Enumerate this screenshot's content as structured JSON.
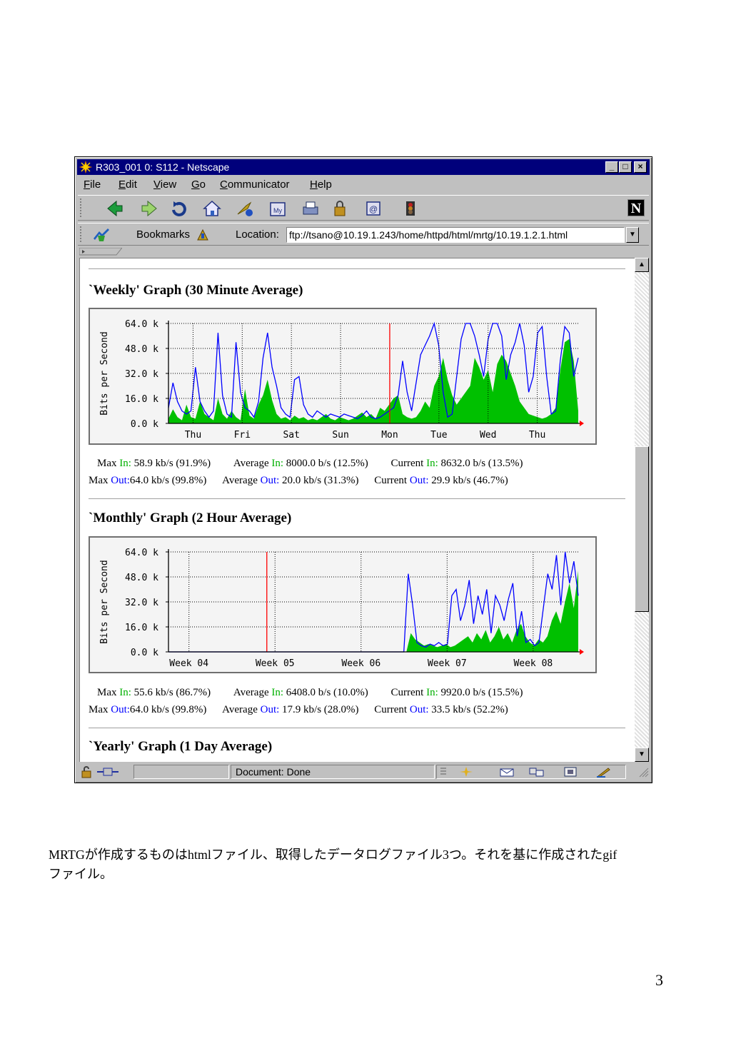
{
  "window": {
    "title": "R303_001 0: S112 - Netscape",
    "buttons": [
      "_",
      "□",
      "×"
    ]
  },
  "menu": [
    {
      "key": "F",
      "rest": "ile"
    },
    {
      "key": "E",
      "rest": "dit"
    },
    {
      "key": "V",
      "rest": "iew"
    },
    {
      "key": "G",
      "rest": "o"
    },
    {
      "key": "C",
      "rest": "ommunicator"
    },
    {
      "key": "H",
      "rest": "elp"
    }
  ],
  "toolbar": {
    "icons": [
      "back-icon",
      "forward-icon",
      "reload-icon",
      "home-icon",
      "search-icon",
      "my-netscape-icon",
      "print-icon",
      "security-icon",
      "stop-at-icon",
      "stop-icon"
    ],
    "brand": "N"
  },
  "location": {
    "bookmarks_label": "Bookmarks",
    "location_label": "Location:",
    "url": "ftp://tsano@10.19.1.243/home/httpd/html/mrtg/10.19.1.2.1.html"
  },
  "content": {
    "weekly": {
      "heading": "`Weekly' Graph (30 Minute Average)",
      "stats_row1": [
        {
          "label": "Max ",
          "kind": "In:",
          "value": " 58.9 kb/s (91.9%)"
        },
        {
          "label": "Average ",
          "kind": "In:",
          "value": " 8000.0 b/s (12.5%)"
        },
        {
          "label": "Current ",
          "kind": "In:",
          "value": " 8632.0 b/s (13.5%)"
        }
      ],
      "stats_row2": [
        {
          "label": "Max ",
          "kind": "Out:",
          "value": "64.0 kb/s (99.8%)"
        },
        {
          "label": "Average ",
          "kind": "Out:",
          "value": " 20.0 kb/s (31.3%)"
        },
        {
          "label": "Current ",
          "kind": "Out:",
          "value": " 29.9 kb/s (46.7%)"
        }
      ]
    },
    "monthly": {
      "heading": "`Monthly' Graph (2 Hour Average)",
      "stats_row1": [
        {
          "label": "Max ",
          "kind": "In:",
          "value": " 55.6 kb/s (86.7%)"
        },
        {
          "label": "Average ",
          "kind": "In:",
          "value": " 6408.0 b/s (10.0%)"
        },
        {
          "label": "Current ",
          "kind": "In:",
          "value": " 9920.0 b/s (15.5%)"
        }
      ],
      "stats_row2": [
        {
          "label": "Max ",
          "kind": "Out:",
          "value": "64.0 kb/s (99.8%)"
        },
        {
          "label": "Average ",
          "kind": "Out:",
          "value": " 17.9 kb/s (28.0%)"
        },
        {
          "label": "Current ",
          "kind": "Out:",
          "value": " 33.5 kb/s (52.2%)"
        }
      ]
    },
    "yearly": {
      "heading": "`Yearly' Graph (1 Day Average)"
    }
  },
  "status": {
    "text": "Document: Done"
  },
  "page": {
    "caption_line1": "MRTGが作成するものはhtmlファイル、取得したデータログファイル3つ。それを基に作成されたgif",
    "caption_line2": "ファイル。",
    "page_number": "3"
  },
  "colors": {
    "in": "#00c000",
    "out": "#0000ff",
    "marker": "#ff0000"
  },
  "chart_data": [
    {
      "type": "area",
      "ylabel": "Bits per Second",
      "ylim": [
        0,
        64000
      ],
      "yticks": [
        "64.0 k",
        "48.0 k",
        "32.0 k",
        "16.0 k",
        "0.0 k"
      ],
      "x_labels": [
        "Thu",
        "Fri",
        "Sat",
        "Sun",
        "Mon",
        "Tue",
        "Wed",
        "Thu"
      ],
      "series": [
        {
          "name": "In",
          "values": [
            3,
            9,
            4,
            2,
            12,
            4,
            3,
            14,
            6,
            4,
            2,
            16,
            6,
            3,
            8,
            4,
            2,
            22,
            5,
            3,
            12,
            18,
            28,
            15,
            6,
            3,
            4,
            2,
            5,
            3,
            4,
            2,
            3,
            2,
            4,
            6,
            3,
            2,
            4,
            3,
            2,
            3,
            5,
            7,
            4,
            6,
            3,
            10,
            8,
            12,
            16,
            18,
            6,
            4,
            3,
            4,
            8,
            14,
            10,
            24,
            30,
            42,
            28,
            18,
            12,
            16,
            20,
            24,
            42,
            36,
            28,
            34,
            20,
            38,
            44,
            40,
            32,
            24,
            14,
            10,
            6,
            5,
            4,
            3,
            4,
            6,
            10,
            34,
            52,
            54,
            40,
            8
          ]
        },
        {
          "name": "Out",
          "values": [
            10,
            26,
            14,
            8,
            6,
            8,
            36,
            14,
            8,
            4,
            8,
            58,
            18,
            6,
            4,
            52,
            20,
            10,
            8,
            4,
            14,
            42,
            58,
            36,
            24,
            10,
            6,
            4,
            28,
            30,
            12,
            6,
            4,
            8,
            6,
            4,
            6,
            5,
            4,
            6,
            5,
            4,
            3,
            5,
            8,
            4,
            3,
            4,
            6,
            8,
            10,
            18,
            40,
            20,
            8,
            26,
            44,
            50,
            56,
            64,
            50,
            20,
            4,
            6,
            30,
            54,
            64,
            64,
            56,
            44,
            30,
            54,
            64,
            64,
            56,
            28,
            44,
            52,
            64,
            50,
            20,
            30,
            58,
            62,
            30,
            6,
            8,
            40,
            62,
            58,
            30,
            42
          ]
        }
      ]
    },
    {
      "type": "area",
      "ylabel": "Bits per Second",
      "ylim": [
        0,
        64000
      ],
      "yticks": [
        "64.0 k",
        "48.0 k",
        "32.0 k",
        "16.0 k",
        "0.0 k"
      ],
      "x_labels": [
        "Week 04",
        "Week 05",
        "Week 06",
        "Week 07",
        "Week 08"
      ],
      "series": [
        {
          "name": "In",
          "values": [
            0,
            0,
            0,
            0,
            0,
            0,
            0,
            0,
            0,
            0,
            0,
            0,
            0,
            0,
            0,
            0,
            0,
            0,
            0,
            0,
            0,
            0,
            0,
            0,
            0,
            0,
            0,
            0,
            0,
            0,
            0,
            0,
            0,
            0,
            0,
            0,
            0,
            0,
            0,
            0,
            0,
            0,
            0,
            0,
            0,
            0,
            0,
            0,
            0,
            0,
            0,
            0,
            0,
            0,
            0,
            12,
            8,
            6,
            4,
            5,
            4,
            3,
            4,
            5,
            3,
            4,
            6,
            8,
            10,
            6,
            12,
            8,
            14,
            6,
            10,
            16,
            8,
            12,
            6,
            14,
            18,
            10,
            6,
            4,
            8,
            6,
            10,
            20,
            26,
            18,
            32,
            44,
            28,
            52
          ]
        },
        {
          "name": "Out",
          "values": [
            0,
            0,
            0,
            0,
            0,
            0,
            0,
            0,
            0,
            0,
            0,
            0,
            0,
            0,
            0,
            0,
            0,
            0,
            0,
            0,
            0,
            0,
            0,
            0,
            0,
            0,
            0,
            0,
            0,
            0,
            0,
            0,
            0,
            0,
            0,
            0,
            0,
            0,
            0,
            0,
            0,
            0,
            0,
            0,
            0,
            0,
            0,
            0,
            0,
            0,
            0,
            0,
            0,
            0,
            0,
            50,
            30,
            6,
            4,
            3,
            5,
            4,
            6,
            4,
            5,
            36,
            40,
            20,
            30,
            46,
            18,
            36,
            24,
            40,
            12,
            36,
            30,
            20,
            34,
            44,
            10,
            26,
            6,
            8,
            4,
            6,
            28,
            50,
            40,
            62,
            30,
            64,
            44,
            58,
            36
          ]
        }
      ]
    }
  ]
}
